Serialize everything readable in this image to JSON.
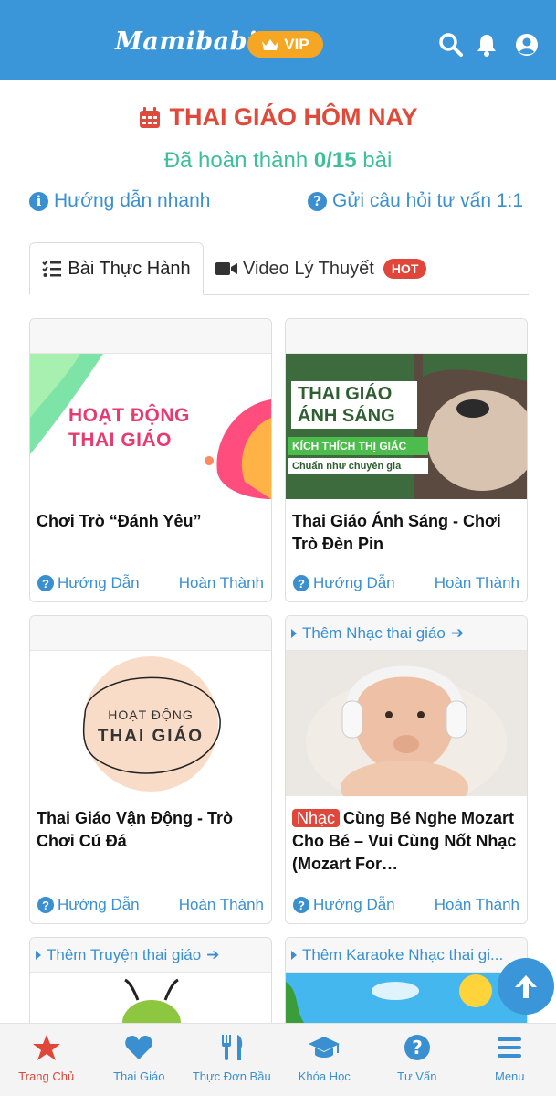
{
  "header": {
    "logo": "Mamibabi",
    "vip_label": "VIP"
  },
  "page": {
    "title": "THAI GIÁO HÔM NAY",
    "progress_prefix": "Đã hoàn thành",
    "progress_done": "0",
    "progress_total": "/15",
    "progress_suffix": "bài",
    "quick_guide": "Hướng dẫn nhanh",
    "ask_question": "Gửi câu hỏi tư vấn 1:1"
  },
  "tabs": [
    {
      "label": "Bài Thực Hành",
      "active": true
    },
    {
      "label": "Video Lý Thuyết",
      "badge": "HOT"
    }
  ],
  "cards": [
    {
      "top": "",
      "image_text_1": "HOẠT ĐỘNG",
      "image_text_2": "THAI GIÁO",
      "title": "Chơi Trò “Đánh Yêu”",
      "guide": "Hướng Dẫn",
      "done": "Hoàn Thành"
    },
    {
      "top": "",
      "image_text_1": "THAI GIÁO",
      "image_text_2": "ÁNH SÁNG",
      "image_text_3": "KÍCH THÍCH THỊ GIÁC",
      "image_text_4": "Chuẩn như chuyên gia",
      "title": "Thai Giáo Ánh Sáng - Chơi Trò Đèn Pin",
      "guide": "Hướng Dẫn",
      "done": "Hoàn Thành"
    },
    {
      "top": "",
      "image_text_1": "HOẠT ĐỘNG",
      "image_text_2": "THAI GIÁO",
      "title": "Thai Giáo Vận Động - Trò Chơi Cú Đá",
      "guide": "Hướng Dẫn",
      "done": "Hoàn Thành"
    },
    {
      "top": "Thêm Nhạc thai giáo",
      "badge": "Nhạc",
      "title": "Cùng Bé Nghe Mozart Cho Bé – Vui Cùng Nốt Nhạc (Mozart For…",
      "guide": "Hướng Dẫn",
      "done": "Hoàn Thành"
    },
    {
      "top": "Thêm Truyện thai giáo"
    },
    {
      "top": "Thêm Karaoke Nhạc thai gi..."
    }
  ],
  "bottom_nav": [
    {
      "label": "Trang Chủ",
      "icon": "star-icon",
      "active": true
    },
    {
      "label": "Thai Giáo",
      "icon": "heart-icon"
    },
    {
      "label": "Thực Đơn Bầu",
      "icon": "utensils-icon"
    },
    {
      "label": "Khóa Học",
      "icon": "graduation-cap-icon"
    },
    {
      "label": "Tư Vấn",
      "icon": "question-circle-icon"
    },
    {
      "label": "Menu",
      "icon": "menu-icon"
    }
  ],
  "colors": {
    "brand": "#3a96d8",
    "accent": "#e04a3a",
    "progress": "#3cbf9a",
    "vip": "#f5a623"
  }
}
